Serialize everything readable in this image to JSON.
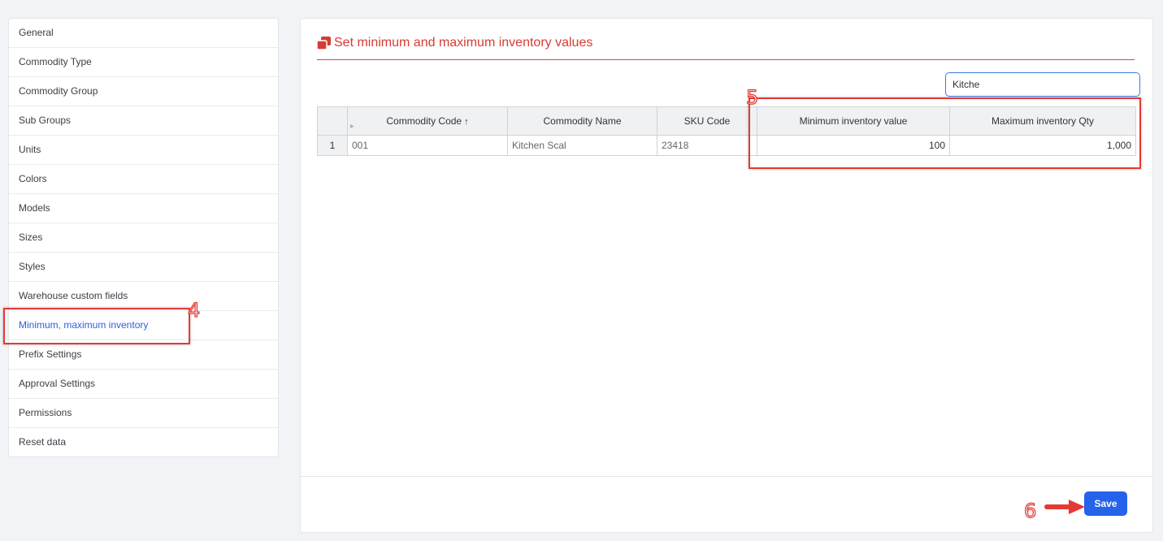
{
  "sidebar": {
    "items": [
      {
        "label": "General"
      },
      {
        "label": "Commodity Type"
      },
      {
        "label": "Commodity Group"
      },
      {
        "label": "Sub Groups"
      },
      {
        "label": "Units"
      },
      {
        "label": "Colors"
      },
      {
        "label": "Models"
      },
      {
        "label": "Sizes"
      },
      {
        "label": "Styles"
      },
      {
        "label": "Warehouse custom fields"
      },
      {
        "label": "Minimum, maximum inventory",
        "active": true
      },
      {
        "label": "Prefix Settings"
      },
      {
        "label": "Approval Settings"
      },
      {
        "label": "Permissions"
      },
      {
        "label": "Reset data"
      }
    ]
  },
  "main": {
    "title": "Set minimum and maximum inventory values",
    "title_icon": "copy-icon",
    "search": {
      "value": "Kitche",
      "placeholder": ""
    },
    "table": {
      "columns": [
        "Commodity Code",
        "Commodity Name",
        "SKU Code",
        "Minimum inventory value",
        "Maximum inventory Qty"
      ],
      "sort_indicator": "↑",
      "rows": [
        {
          "row_number": "1",
          "code": "001",
          "name": "Kitchen Scal",
          "sku": "23418",
          "min": "100",
          "max": "1,000"
        }
      ]
    },
    "save_label": "Save"
  },
  "annotations": {
    "step4": "4",
    "step5": "5",
    "step6": "6",
    "color": "#e53935"
  },
  "colors": {
    "accent": "#d83b34",
    "primary_button": "#2563eb",
    "active_link": "#2e5fd9"
  }
}
